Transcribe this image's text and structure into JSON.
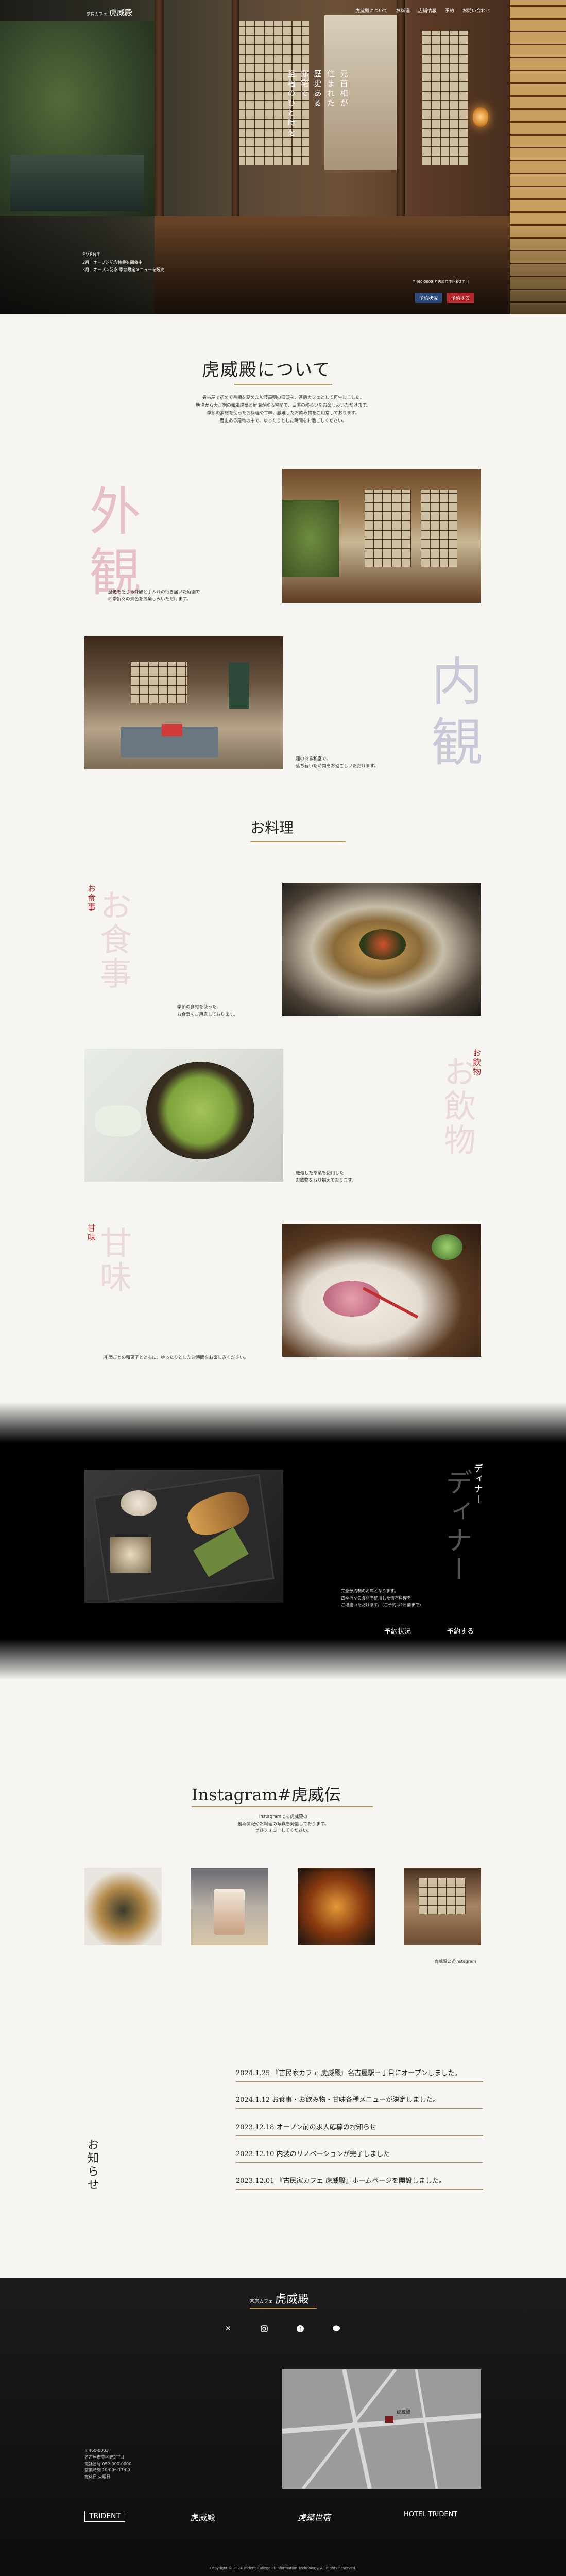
{
  "header": {
    "logo_small": "茶房カフェ",
    "logo": "虎威殿",
    "nav": [
      "虎威殿について",
      "お料理",
      "店舗情報",
      "予約",
      "お問い合わせ"
    ]
  },
  "hero": {
    "catch_lines": [
      "元首相が",
      "住まれた",
      "歴史ある",
      "邸宅で",
      "至福のひと時を"
    ],
    "event_label": "EVENT",
    "event_lines": [
      "2月　オープン記念特典を開催中",
      "3月　オープン記念 季節限定メニューを販売"
    ],
    "address": "〒460-0003 名古屋市中区錦2丁目",
    "btn_status": "予約状況",
    "btn_reserve": "予約する"
  },
  "about": {
    "title": "虎威殿について",
    "body": [
      "名古屋で初めて首相を務めた加藤高明の旧邸を、茶房カフェとして再生しました。",
      "明治から大正期の和風建築と庭園が残る空間で、四季の移ろいをお楽しみいただけます。",
      "季節の素材を使ったお料理や甘味、厳選したお飲み物をご用意しております。",
      "歴史ある建物の中で、ゆったりとした時間をお過ごしください。"
    ],
    "exterior_kanji": "外観",
    "exterior_caption": [
      "歴史を感じる外観と手入れの行き届いた庭園で",
      "四季折々の景色をお楽しみいただけます。"
    ],
    "interior_kanji": "内観",
    "interior_caption": [
      "趣のある和室で、",
      "落ち着いた時間をお過ごしいただけます。"
    ]
  },
  "food": {
    "title": "お料理",
    "meal_label": "お食事",
    "meal_kanji": "お食事",
    "meal_caption": [
      "季節の食材を使った",
      "お食事をご用意しております。"
    ],
    "drink_label": "お飲物",
    "drink_kanji": "お飲物",
    "drink_caption": [
      "厳選した茶葉を使用した",
      "お飲物を取り揃えております。"
    ],
    "sweet_label": "甘味",
    "sweet_kanji": "甘味",
    "sweet_caption": [
      "季節ごとの和菓子とともに、ゆったりとしたお時間をお楽しみください。"
    ]
  },
  "dinner": {
    "label": "ディナー",
    "kanji": "ディナー",
    "caption": [
      "完全予約制のお席となります。",
      "四季折々の食材を使用した懐石料理を",
      "ご堪能いただけます。（ご予約は2日前まで）"
    ],
    "btn_status": "予約状況",
    "btn_reserve": "予約する"
  },
  "instagram": {
    "title": "Instagram#虎威伝",
    "desc": [
      "Instagramでも虎威殿の",
      "最新情報やお料理の写真を発信しております。",
      "ぜひフォローしてください。"
    ],
    "link": "虎威殿公式Instagram"
  },
  "news": {
    "title": "お知らせ",
    "items": [
      "2024.1.25 『古民家カフェ 虎威殿』名古屋駅三丁目にオープンしました。",
      "2024.1.12 お食事・お飲み物・甘味各種メニューが決定しました。",
      "2023.12.18 オープン前の求人応募のお知らせ",
      "2023.12.10 内装のリノベーションが完了しました",
      "2023.12.01 『古民家カフェ 虎威殿』ホームページを開設しました。"
    ]
  },
  "footer": {
    "logo_small": "茶房カフェ",
    "logo": "虎威殿",
    "sns": [
      "x-icon",
      "instagram-icon",
      "facebook-icon",
      "line-icon"
    ],
    "map_label": "虎威殿",
    "address_lines": [
      "〒460-0003",
      "名古屋市中区錦2丁目",
      "電話番号 052-000-0000",
      "営業時間 10:00〜17:00",
      "定休日 火曜日"
    ],
    "brands": [
      "TRIDENT",
      "虎威殿",
      "虎織世宿",
      "HOTEL TRIDENT"
    ],
    "copyright": "Copyright © 2024 Trident College of Information Technology. All Rights Reserved."
  }
}
